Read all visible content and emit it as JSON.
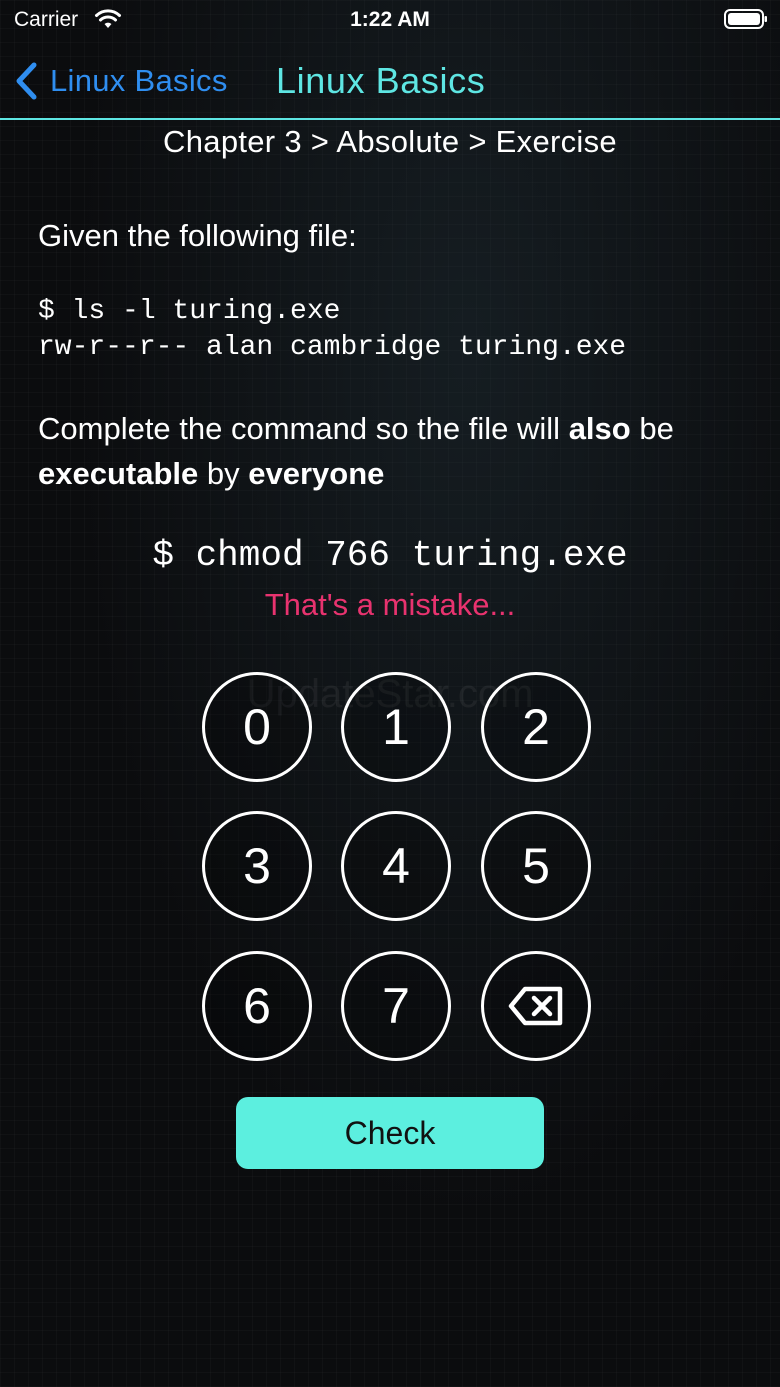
{
  "status_bar": {
    "carrier": "Carrier",
    "time": "1:22 AM",
    "wifi_icon": "wifi-icon",
    "battery_icon": "battery-icon"
  },
  "nav": {
    "back_label": "Linux Basics",
    "title": "Linux Basics",
    "accent_color": "#5ee6e3",
    "back_color": "#2f8ef0"
  },
  "breadcrumb": "Chapter 3 > Absolute > Exercise",
  "exercise": {
    "intro": "Given the following file:",
    "code_lines": [
      "$ ls -l turing.exe",
      "rw-r--r-- alan cambridge turing.exe"
    ],
    "question": {
      "part1": "Complete the command so the file will ",
      "bold1": "also",
      "part2": " be ",
      "bold2": "executable",
      "part3": " by ",
      "bold3": "everyone"
    },
    "command": "$ chmod 766 turing.exe",
    "feedback": "That's a mistake...",
    "feedback_color": "#e8336f"
  },
  "watermark": "UpdateStar.com",
  "keypad": {
    "keys": [
      "0",
      "1",
      "2",
      "3",
      "4",
      "5",
      "6",
      "7"
    ],
    "delete_icon": "delete-icon"
  },
  "check_button": {
    "label": "Check",
    "color": "#5cefdf"
  }
}
